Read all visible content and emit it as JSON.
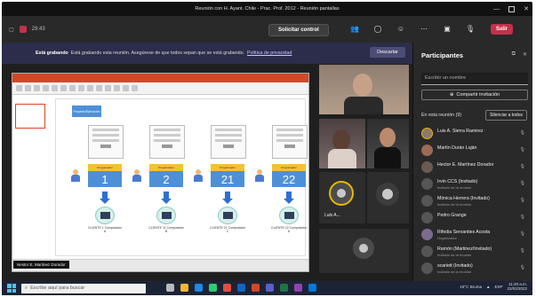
{
  "window": {
    "title": "Reunión con H. Ayant. Chile - Prac. Prof. 2012 - Reunión pantallas",
    "minimize": "—",
    "restore": "",
    "close": "✕"
  },
  "toolbar": {
    "timer": "29:43",
    "stop_sharing_label": "Solicitar control",
    "hang_up_label": "Salir",
    "hang_up_icon": "phone-icon"
  },
  "banner": {
    "bold": "Está grabando",
    "text": "Está grabando esta reunión. Asegúrese de que todos sepan que se está grabando.",
    "link": "Política de privacidad",
    "dismiss": "Descartar"
  },
  "presentation": {
    "label_box": "Proyecto/Ejecución",
    "numbers": [
      "1",
      "2",
      "21",
      "22"
    ],
    "num_headers": [
      "Programador",
      "Programador",
      "Programador",
      "Programador"
    ],
    "clients": [
      "CLIENTE 1\nComputador A",
      "CLIENTE 11\nComputador B",
      "CLIENTE 21\nComputador C",
      "CLIENTE 22\nComputador D"
    ],
    "presenter_badge": "Nestor E. Martinez Dorador"
  },
  "stage": {
    "tile_label": "Luis A..."
  },
  "panel": {
    "title": "Participantes",
    "search_placeholder": "Escribir un nombre",
    "share_label": "Compartir invitación",
    "in_meeting": "En esta reunión (9)",
    "mute_all": "Silenciar a todos",
    "participants": [
      {
        "name": "Luis A. Sierra Ramirez",
        "sub": ""
      },
      {
        "name": "Martín Durán Luján",
        "sub": ""
      },
      {
        "name": "Hector E. Martínez Dorador",
        "sub": ""
      },
      {
        "name": "Irvin CCS (Invitado)",
        "sub": "Invitado de la reunión"
      },
      {
        "name": "Mónica Herrera (Invitado)",
        "sub": "Invitado de la reunión"
      },
      {
        "name": "Pedro Grange",
        "sub": ""
      },
      {
        "name": "Rifedia Servanties Acosta",
        "sub": "Organizador"
      },
      {
        "name": "Ramón (Martinez/Invitado)",
        "sub": "Invitado de la reunión"
      },
      {
        "name": "scarlett (Invitado)",
        "sub": "Invitado de la reunión"
      }
    ]
  },
  "taskbar": {
    "search_placeholder": "Escribe aquí para buscar",
    "weather": "19°C Bruma",
    "time": "11:20 a.m.",
    "date": "22/02/2022",
    "lang": "ESP"
  },
  "colors": {
    "accent": "#4e90d8",
    "hangup": "#c4314b",
    "banner": "#2b2d4a"
  }
}
